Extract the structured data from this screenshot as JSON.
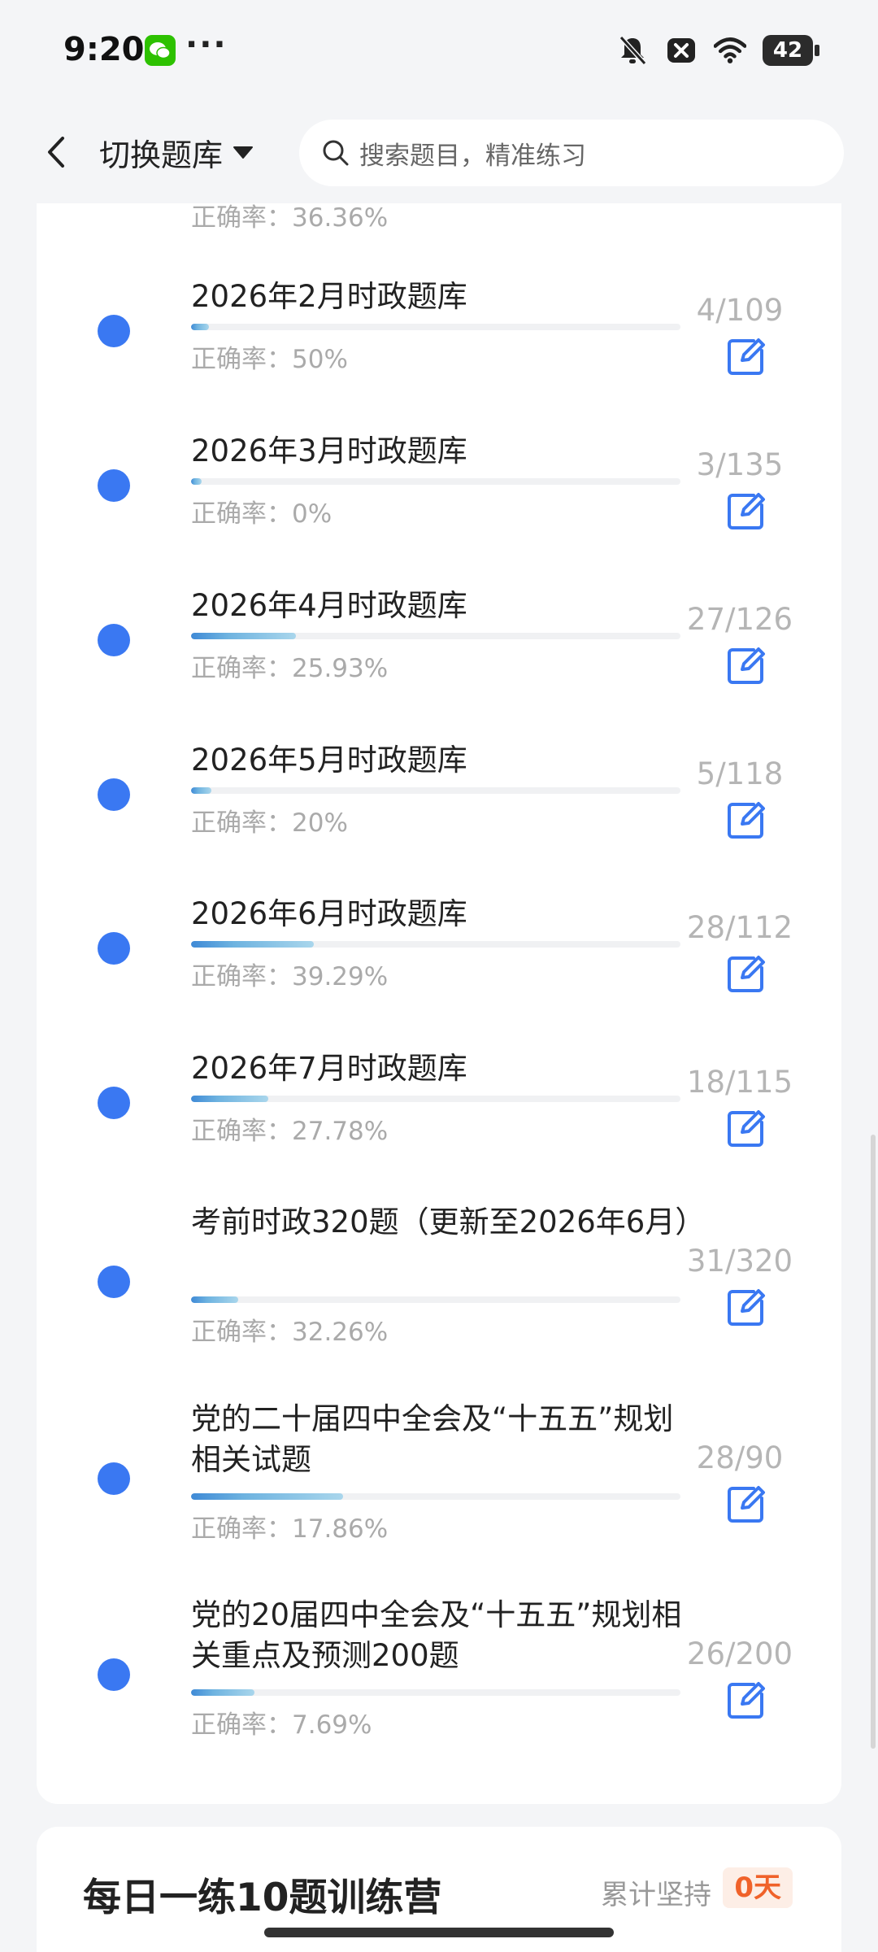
{
  "status_bar": {
    "time": "9:20",
    "more": "···",
    "battery": "42",
    "icons": [
      "wechat-icon",
      "mute-bell-icon",
      "close-notification-icon",
      "wifi-icon",
      "battery-icon"
    ]
  },
  "header": {
    "back_icon": "chevron-left-icon",
    "switch_label": "切换题库",
    "dropdown_icon": "caret-down-icon",
    "search_icon": "search-icon",
    "search_placeholder": "搜索题目，精准练习"
  },
  "list": {
    "partial_top_rate": "正确率：36.36%",
    "items": [
      {
        "title": "2026年2月时政题库",
        "count": "4/109",
        "rate": "正确率：50%",
        "progress": 0.037,
        "correct_ratio": 0.5
      },
      {
        "title": "2026年3月时政题库",
        "count": "3/135",
        "rate": "正确率：0%",
        "progress": 0.022,
        "correct_ratio": 0.0
      },
      {
        "title": "2026年4月时政题库",
        "count": "27/126",
        "rate": "正确率：25.93%",
        "progress": 0.214,
        "correct_ratio": 0.2593
      },
      {
        "title": "2026年5月时政题库",
        "count": "5/118",
        "rate": "正确率：20%",
        "progress": 0.042,
        "correct_ratio": 0.2
      },
      {
        "title": "2026年6月时政题库",
        "count": "28/112",
        "rate": "正确率：39.29%",
        "progress": 0.25,
        "correct_ratio": 0.3929
      },
      {
        "title": "2026年7月时政题库",
        "count": "18/115",
        "rate": "正确率：27.78%",
        "progress": 0.157,
        "correct_ratio": 0.2778
      },
      {
        "title": "考前时政320题（更新至2026年6月）",
        "count": "31/320",
        "rate": "正确率：32.26%",
        "progress": 0.097,
        "correct_ratio": 0.3226
      },
      {
        "title": "党的二十届四中全会及“十五五”规划相关试题",
        "count": "28/90",
        "rate": "正确率：17.86%",
        "progress": 0.311,
        "correct_ratio": 0.1786
      },
      {
        "title": "党的20届四中全会及“十五五”规划相关重点及预测200题",
        "count": "26/200",
        "rate": "正确率：7.69%",
        "progress": 0.13,
        "correct_ratio": 0.0769
      }
    ]
  },
  "bottom_card": {
    "title": "每日一练10题训练营",
    "streak_label": "累计坚持",
    "streak_value": "0天"
  },
  "colors": {
    "dot": "#3a78f2",
    "edit_icon": "#3a78f2",
    "badge_text": "#f0622a",
    "badge_bg": "#fdeee6"
  }
}
